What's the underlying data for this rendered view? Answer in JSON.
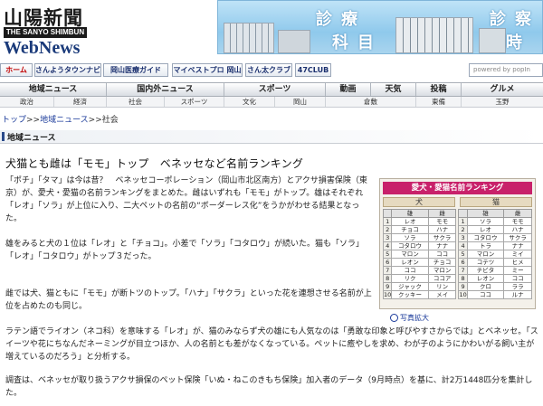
{
  "header": {
    "logo_jp": "山陽新聞",
    "logo_sub": "THE SANYO SHIMBUN",
    "logo_web": "WebNews",
    "banner": {
      "word1": "診療",
      "word2": "科目",
      "word3": "診察",
      "word4": "時間"
    }
  },
  "services": {
    "home": "ホーム",
    "s1": "さんようタウンナビ",
    "s2": "岡山医療ガイド",
    "s3": "マイベストプロ 岡山",
    "s4": "さん太クラブ",
    "s5": "47CLUB",
    "search_placeholder": "powered by popIn"
  },
  "nav": {
    "items": [
      "地域ニュース",
      "国内外ニュース",
      "スポーツ",
      "動画",
      "天気",
      "投稿",
      "グルメ"
    ],
    "sub": [
      "政治",
      "経済",
      "社会",
      "スポーツ",
      "文化",
      "岡山",
      "倉敷",
      "東備",
      "玉野"
    ]
  },
  "breadcrumb": {
    "top": "トップ",
    "region": "地域ニュース",
    "current": "社会",
    "sep": ">>"
  },
  "section": "地域ニュース",
  "article": {
    "title": "犬猫とも雌は「モモ」トップ　ベネッセなど名前ランキング",
    "p1": "「ポチ」「タマ」は今は昔？　ベネッセコーポレーション（岡山市北区南方）とアクサ損害保険（東京）が、愛犬・愛猫の名前ランキングをまとめた。雌はいずれも「モモ」がトップ。雄はそれぞれ「レオ」「ソラ」が上位に入り、二大ペットの名前の“ボーダーレス化”をうかがわせる結果となった。",
    "p2": "雄をみると犬の１位は「レオ」と「チョコ」。小差で「ソラ」「コタロウ」が続いた。猫も「ソラ」「レオ」「コタロウ」がトップ３だった。",
    "p3": "雌では犬、猫ともに「モモ」が断トツのトップ。「ハナ」「サクラ」といった花を連想させる名前が上位を占めたのも同じ。",
    "p4": "ラテン語でライオン（ネコ科）を意味する「レオ」が、猫のみならず犬の雄にも人気なのは「勇敢な印象と呼びやすさからでは」とベネッセ。「スイーツや花にちなんだネーミングが目立つほか、人の名前とも差がなくなっている。ペットに癒やしを求め、わが子のようにかわいがる飼い主が増えているのだろう」と分析する。",
    "p5": "調査は、ベネッセが取り扱うアクサ損保のペット保険「いぬ・ねこのきもち保険」加入者のデータ（9月時点）を基に、計2万1448匹分を集計した。"
  },
  "figure": {
    "title": "愛犬・愛猫名前ランキング",
    "dog_label": "犬",
    "cat_label": "猫",
    "male": "雄",
    "female": "雌",
    "ranks": [
      "1",
      "2",
      "3",
      "4",
      "5",
      "6",
      "7",
      "8",
      "9",
      "10"
    ],
    "dog_male": [
      "レオ",
      "チョコ",
      "ソラ",
      "コタロウ",
      "マロン",
      "レオン",
      "ココ",
      "リク",
      "ジャック",
      "クッキー"
    ],
    "dog_female": [
      "モモ",
      "ハナ",
      "サクラ",
      "ナナ",
      "ココ",
      "チョコ",
      "マロン",
      "ココア",
      "リン",
      "メイ"
    ],
    "cat_male": [
      "ソラ",
      "レオ",
      "コタロウ",
      "トラ",
      "マロン",
      "コテツ",
      "チビタ",
      "レオン",
      "クロ",
      "ココ"
    ],
    "cat_female": [
      "モモ",
      "ハナ",
      "サクラ",
      "ナナ",
      "ミイ",
      "ヒメ",
      "ミー",
      "ココ",
      "ララ",
      "ルナ"
    ],
    "zoom": "写真拡大"
  }
}
